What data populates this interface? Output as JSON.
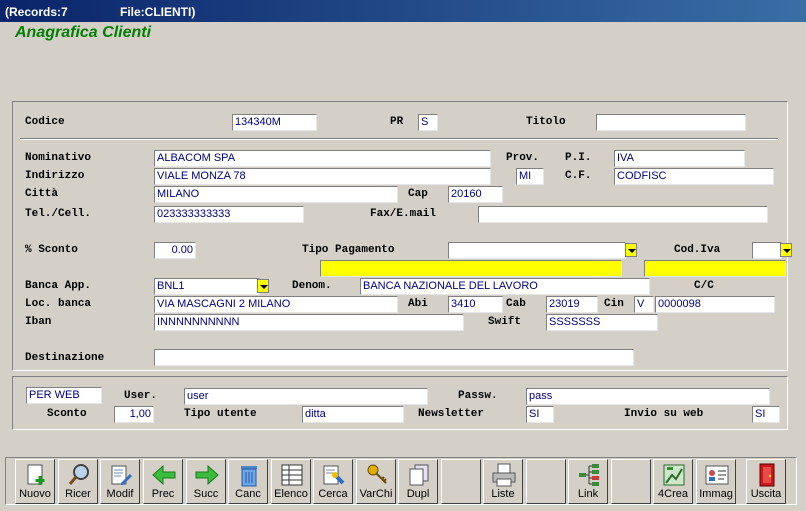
{
  "window": {
    "records": "(Records:7",
    "file": "File:CLIENTI)"
  },
  "heading": "Anagrafica Clienti",
  "form": {
    "codice": {
      "label": "Codice",
      "value": "134340M"
    },
    "pr": {
      "label": "PR",
      "value": "S"
    },
    "titolo": {
      "label": "Titolo",
      "value": ""
    },
    "nominativo": {
      "label": "Nominativo",
      "value": "ALBACOM SPA"
    },
    "prov": {
      "label": "Prov.",
      "value": "MI"
    },
    "pi": {
      "label": "P.I.",
      "value": "IVA"
    },
    "indirizzo": {
      "label": "Indirizzo",
      "value": "VIALE MONZA 78"
    },
    "cf": {
      "label": "C.F.",
      "value": "CODFISC"
    },
    "citta": {
      "label": "Città",
      "value": "MILANO"
    },
    "cap": {
      "label": "Cap",
      "value": "20160"
    },
    "tel": {
      "label": "Tel./Cell.",
      "value": "023333333333"
    },
    "fax": {
      "label": "Fax/E.mail",
      "value": ""
    },
    "sconto_perc": {
      "label": "% Sconto",
      "value": "0.00"
    },
    "tipo_pagamento": {
      "label": "Tipo Pagamento",
      "value": ""
    },
    "cod_iva": {
      "label": "Cod.Iva",
      "value": ""
    },
    "banca_app": {
      "label": "Banca App.",
      "value": "BNL1"
    },
    "denom": {
      "label": "Denom.",
      "value": "BANCA NAZIONALE DEL LAVORO"
    },
    "cc": {
      "label": "C/C",
      "value": "0000098"
    },
    "loc_banca": {
      "label": "Loc. banca",
      "value": "VIA MASCAGNI 2 MILANO"
    },
    "abi": {
      "label": "Abi",
      "value": "3410"
    },
    "cab": {
      "label": "Cab",
      "value": "23019"
    },
    "cin": {
      "label": "Cin",
      "value": "V"
    },
    "iban": {
      "label": "Iban",
      "value": "INNNNNNNNNN"
    },
    "swift": {
      "label": "Swift",
      "value": "SSSSSSS"
    },
    "destinazione": {
      "label": "Destinazione",
      "value": ""
    }
  },
  "web": {
    "per_web": "PER WEB",
    "user": {
      "label": "User.",
      "value": "user"
    },
    "passw": {
      "label": "Passw.",
      "value": "pass"
    },
    "sconto": {
      "label": "Sconto",
      "value": "1,00"
    },
    "tipo_utente": {
      "label": "Tipo utente",
      "value": "ditta"
    },
    "newsletter": {
      "label": "Newsletter",
      "value": "SI"
    },
    "invio_web": {
      "label": "Invio su web",
      "value": "SI"
    }
  },
  "toolbar": {
    "nuovo": "Nuovo",
    "ricer": "Ricer",
    "modif": "Modif",
    "prec": "Prec",
    "succ": "Succ",
    "canc": "Canc",
    "elenco": "Elenco",
    "cerca": "Cerca",
    "varchi": "VarChi",
    "dupl": "Dupl",
    "liste": "Liste",
    "link": "Link",
    "crea4": "4Crea",
    "immag": "Immag",
    "uscita": "Uscita"
  }
}
